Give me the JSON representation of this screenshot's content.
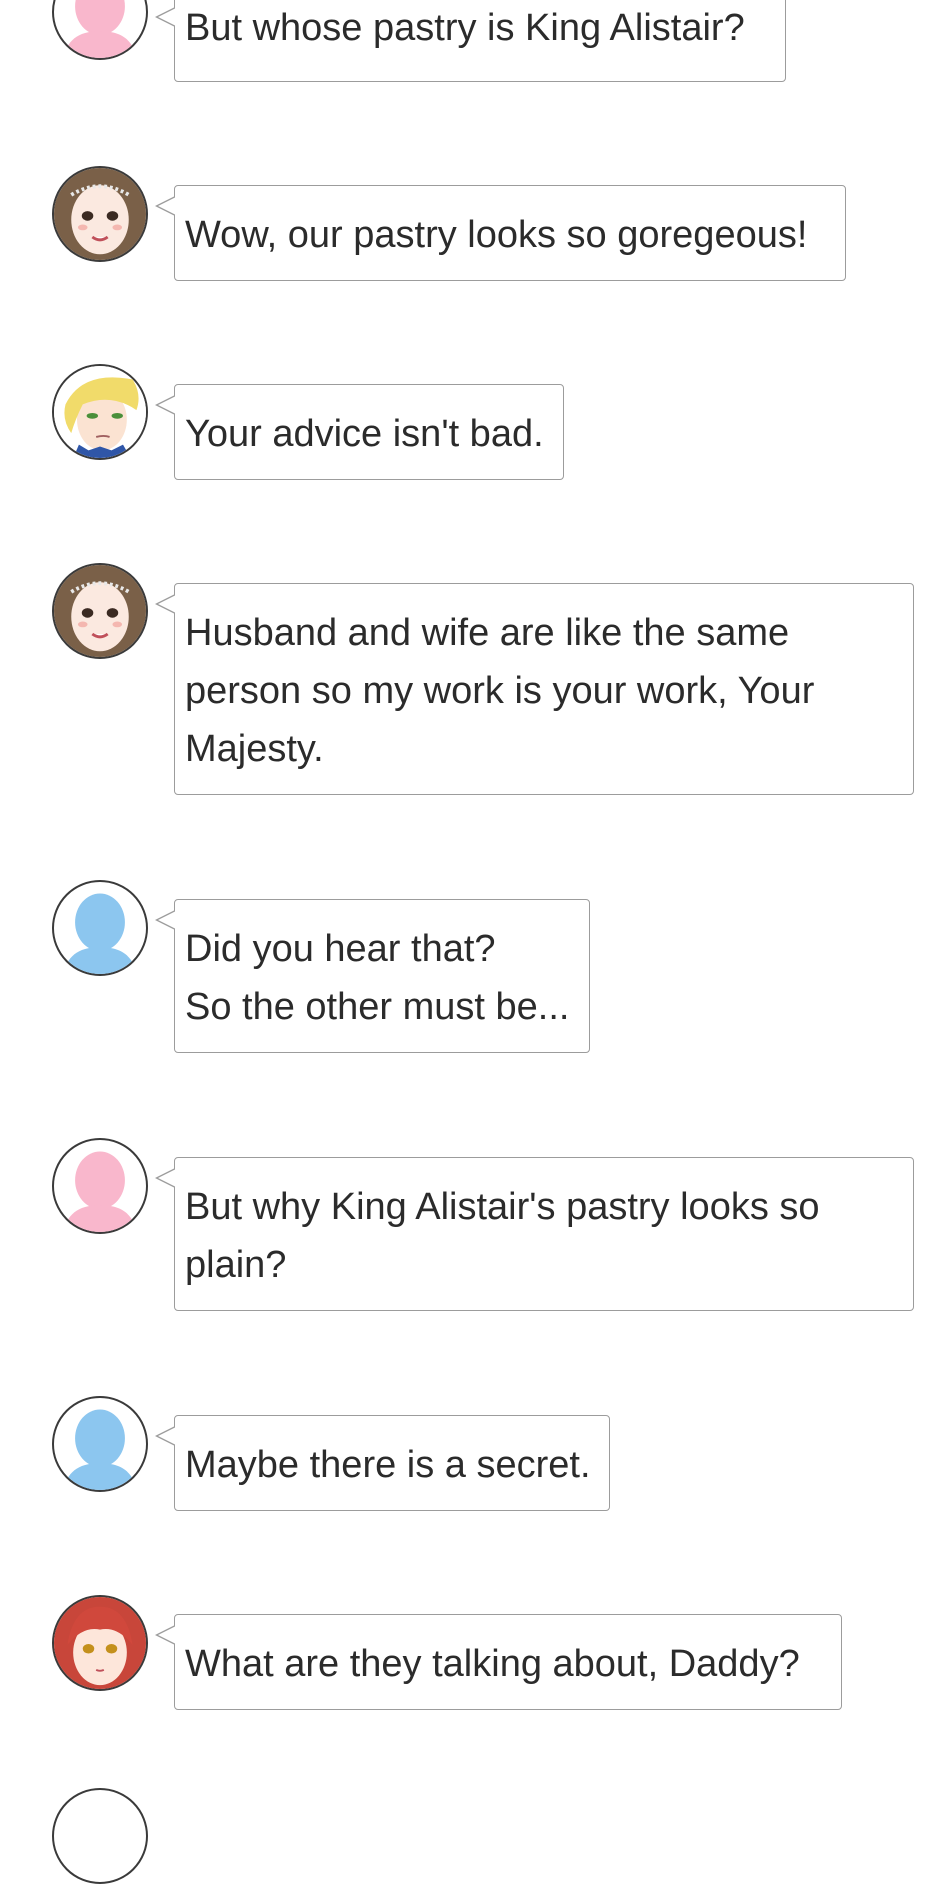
{
  "messages": [
    {
      "avatar": "pink-silhouette-avatar",
      "text": "But whose pastry is King Alistair?"
    },
    {
      "avatar": "queen-avatar",
      "text": "Wow, our pastry looks so goregeous!"
    },
    {
      "avatar": "blond-king-avatar",
      "text": "Your advice isn't bad."
    },
    {
      "avatar": "queen-avatar",
      "text": "Husband and wife are like the same person so my work is your work, Your Majesty."
    },
    {
      "avatar": "blue-silhouette-avatar",
      "text": "Did you hear that?\nSo the other must be..."
    },
    {
      "avatar": "pink-silhouette-avatar",
      "text": "But why King Alistair's pastry looks so plain?"
    },
    {
      "avatar": "blue-silhouette-avatar",
      "text": "Maybe there is a secret."
    },
    {
      "avatar": "red-haired-girl-avatar",
      "text": "What are they talking about, Daddy?"
    }
  ],
  "colors": {
    "pink_silhouette": "#f9b7cc",
    "blue_silhouette": "#8cc6ef",
    "bubble_border": "#9c9c9c"
  }
}
